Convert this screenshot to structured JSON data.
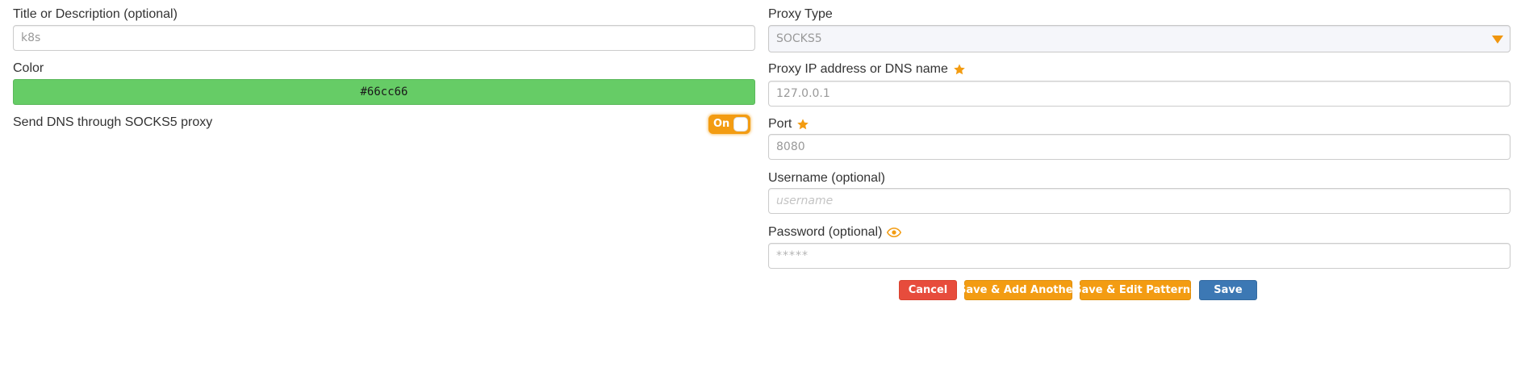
{
  "left": {
    "title_label": "Title or Description (optional)",
    "title_value": "k8s",
    "color_label": "Color",
    "color_value": "#66cc66",
    "dns_label": "Send DNS through SOCKS5 proxy",
    "dns_toggle_text": "On"
  },
  "right": {
    "proxy_type_label": "Proxy Type",
    "proxy_type_value": "SOCKS5",
    "ip_label": "Proxy IP address or DNS name",
    "ip_value": "127.0.0.1",
    "port_label": "Port",
    "port_value": "8080",
    "username_label": "Username (optional)",
    "username_placeholder": "username",
    "password_label": "Password (optional)",
    "password_value": "*****"
  },
  "buttons": {
    "cancel": "Cancel",
    "save_add_another": "Save & Add Another",
    "save_edit_patterns": "Save & Edit Patterns",
    "save": "Save"
  },
  "icons": {
    "required": "star-icon",
    "show_password": "eye-icon",
    "dropdown": "caret-down-icon"
  },
  "colors": {
    "accent": "#f39c12",
    "selected_color": "#66cc66",
    "cancel": "#e74c3c",
    "save": "#3c78b4"
  }
}
